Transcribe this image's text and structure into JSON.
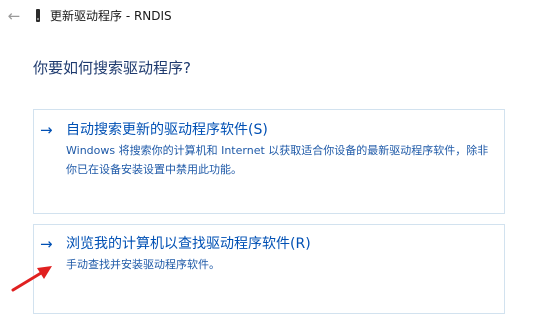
{
  "titlebar": {
    "back_icon": "arrow-left-icon",
    "device_icon": "device-icon",
    "title": "更新驱动程序 - RNDIS"
  },
  "heading": "你要如何搜索驱动程序?",
  "options": [
    {
      "arrow": "→",
      "title": "自动搜索更新的驱动程序软件(S)",
      "description": "Windows 将搜索你的计算机和 Internet 以获取适合你设备的最新驱动程序软件，除非你已在设备安装设置中禁用此功能。"
    },
    {
      "arrow": "→",
      "title": "浏览我的计算机以查找驱动程序软件(R)",
      "description": "手动查找并安装驱动程序软件。"
    }
  ],
  "colors": {
    "link": "#0050b4",
    "heading": "#1e3a6e",
    "option_border": "#d2e2ef",
    "annotation_arrow": "#e02020"
  }
}
